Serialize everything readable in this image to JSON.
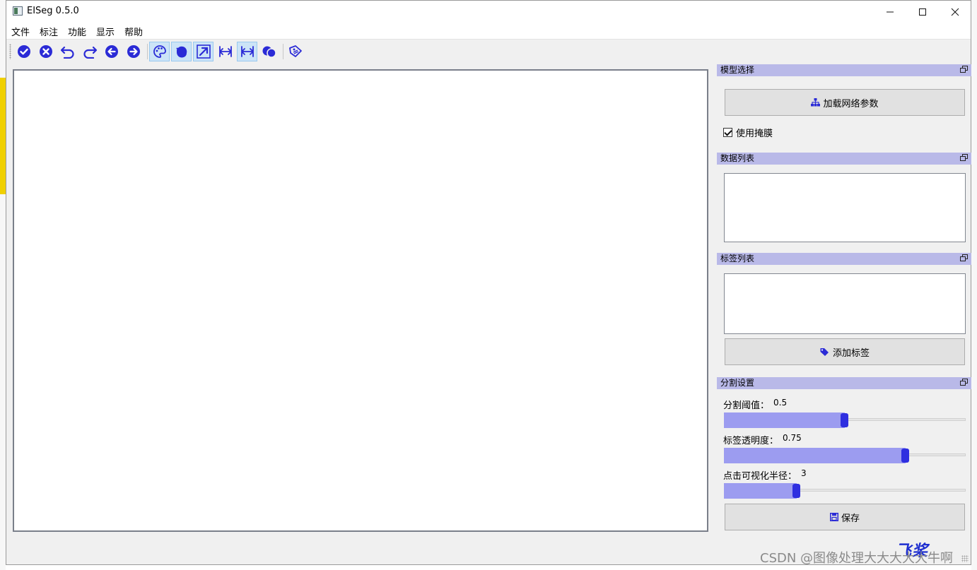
{
  "window": {
    "title": "EISeg 0.5.0",
    "controls": {
      "minimize": "—",
      "maximize": "☐",
      "close": "✕"
    }
  },
  "menu": [
    "文件",
    "标注",
    "功能",
    "显示",
    "帮助"
  ],
  "toolbar": {
    "buttons": [
      {
        "icon": "check-circle-icon",
        "checked": false
      },
      {
        "icon": "x-circle-icon",
        "checked": false
      },
      {
        "icon": "undo-icon",
        "checked": false
      },
      {
        "icon": "redo-icon",
        "checked": false
      },
      {
        "icon": "arrow-left-circle-icon",
        "checked": false
      },
      {
        "icon": "arrow-right-circle-icon",
        "checked": false
      },
      {
        "icon": "palette-icon",
        "checked": true
      },
      {
        "icon": "fill-drop-icon",
        "checked": true
      },
      {
        "icon": "airplane-icon",
        "checked": true
      },
      {
        "icon": "resize-icon",
        "checked": false
      },
      {
        "icon": "resize-icon",
        "checked": true
      },
      {
        "icon": "overlap-circles-icon",
        "checked": false
      },
      {
        "icon": "tag-icon",
        "checked": false
      }
    ],
    "accent": "#2b2bd6"
  },
  "model_panel": {
    "title": "模型选择",
    "load_button": "加载网络参数",
    "use_mask_label": "使用掩膜",
    "use_mask_checked": true
  },
  "data_panel": {
    "title": "数据列表"
  },
  "label_panel": {
    "title": "标签列表",
    "add_button": "添加标签"
  },
  "seg_panel": {
    "title": "分割设置",
    "threshold_label": "分割阈值：",
    "threshold_value": "0.5",
    "threshold_level": 0.5,
    "opacity_label": "标签透明度：",
    "opacity_value": "0.75",
    "opacity_level": 0.75,
    "radius_label": "点击可视化半径：",
    "radius_value": "3",
    "radius_level": 0.3,
    "save_button": "保存"
  },
  "footer": {
    "watermark": "CSDN @图像处理大大大大大牛啊",
    "logo_text": "飞桨"
  },
  "colors": {
    "dock_title_bg": "#b9b9e8",
    "slider_fill": "#9c9cf0",
    "slider_handle": "#2f2fe0"
  }
}
